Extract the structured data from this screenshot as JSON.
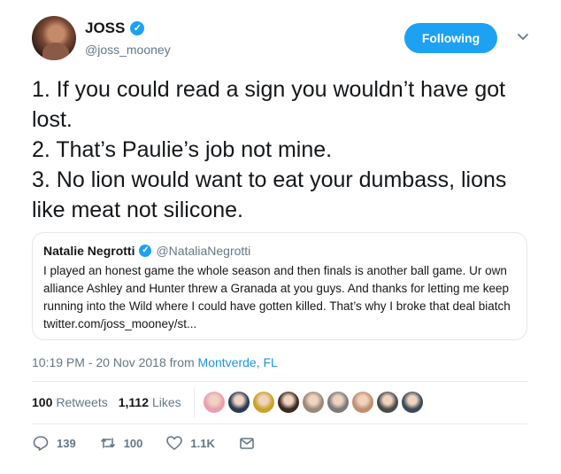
{
  "user": {
    "display_name": "JOSS",
    "handle": "@joss_mooney",
    "follow_label": "Following"
  },
  "tweet": {
    "lines": [
      "1. If you could read a sign you wouldn’t have got lost.",
      "2. That’s Paulie’s job not mine.",
      "3. No lion would want to eat your dumbass, lions like meat not silicone."
    ]
  },
  "quote": {
    "name": "Natalie Negrotti",
    "handle": "@NataliaNegrotti",
    "text": "I played an honest game the whole season and then finals is another ball game. Ur own alliance Ashley and Hunter threw a Granada at you guys.  And thanks for letting me keep running into the Wild where I could have gotten killed. That’s why I broke that deal biatch twitter.com/joss_mooney/st..."
  },
  "meta": {
    "timestamp": "10:19 PM - 20 Nov 2018 from",
    "location": "Montverde, FL"
  },
  "stats": {
    "retweets_count": "100",
    "retweets_label": "Retweets",
    "likes_count": "1,112",
    "likes_label": "Likes"
  },
  "faces": [
    "#e8a0b0",
    "#2a3a55",
    "#c9a227",
    "#3a2a25",
    "#9a8a7a",
    "#7a7a7a",
    "#c09070",
    "#4a4a4a",
    "#3a4a5a"
  ],
  "actions": {
    "reply_count": "139",
    "retweet_count": "100",
    "like_count": "1.1K"
  },
  "colors": {
    "accent": "#1da1f2",
    "link": "#1b95e0",
    "muted": "#657786"
  }
}
